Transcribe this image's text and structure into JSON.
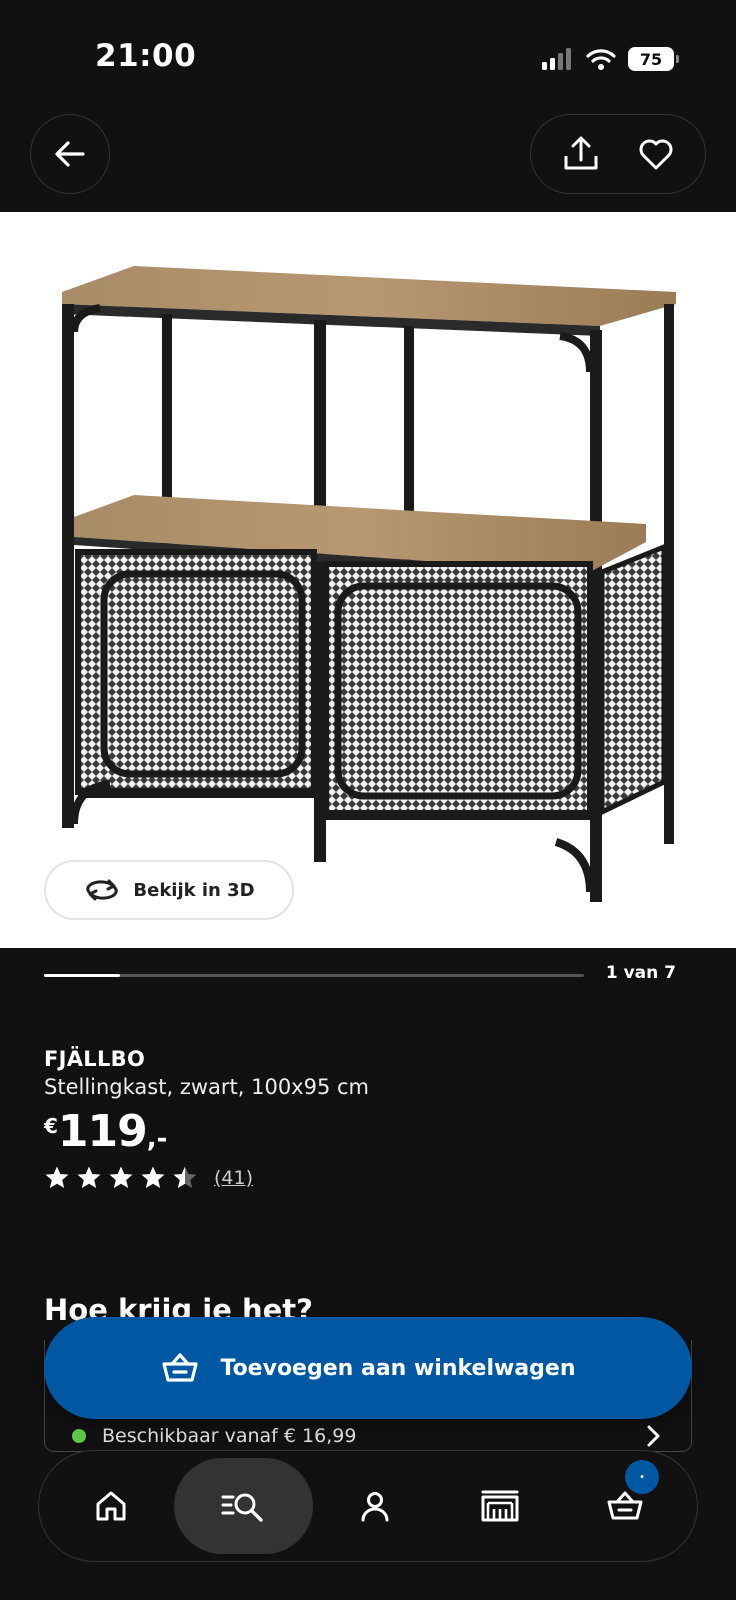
{
  "status_bar": {
    "time": "21:00",
    "battery": "75"
  },
  "header": {
    "back_icon": "arrow-left-icon",
    "share_icon": "share-icon",
    "favorite_icon": "heart-icon"
  },
  "gallery": {
    "view_3d_label": "Bekijk in 3D",
    "pager_text": "1 van 7",
    "progress": 0.14
  },
  "product": {
    "name": "FJÄLLBO",
    "description": "Stellingkast, zwart, 100x95 cm",
    "price_currency": "€",
    "price_amount": "119",
    "price_decimals": ",-",
    "rating": 4.5,
    "rating_max": 5,
    "review_count": "(41)"
  },
  "delivery": {
    "section_title": "Hoe krijg je het?",
    "availability_text": "Beschikbaar vanaf € 16,99",
    "availability_color": "#5ec94a"
  },
  "cta": {
    "label": "Toevoegen aan winkelwagen",
    "color": "#0058a3"
  },
  "bottom_nav": {
    "items": [
      {
        "icon": "home-icon"
      },
      {
        "icon": "search-list-icon",
        "active": true
      },
      {
        "icon": "person-icon"
      },
      {
        "icon": "store-icon"
      },
      {
        "icon": "cart-icon",
        "badge": "•"
      }
    ]
  }
}
